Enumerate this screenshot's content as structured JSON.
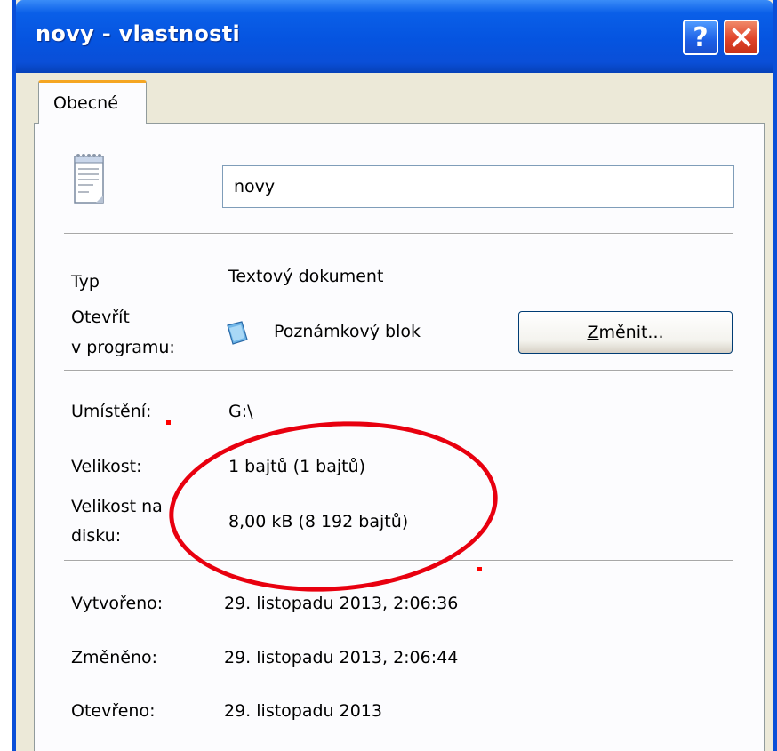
{
  "window": {
    "title": "novy - vlastnosti",
    "help_label": "?",
    "close_label": "✕"
  },
  "tabs": [
    {
      "label": "Obecné",
      "active": true
    }
  ],
  "file": {
    "icon": "notepad-document-icon",
    "name": "novy"
  },
  "props": {
    "type_label": "Typ",
    "type_value": "Textový dokument",
    "open_with_label_1": "Otevřít",
    "open_with_label_2": "v programu:",
    "open_with_app": "Poznámkový blok",
    "open_with_app_icon": "notepad-app-icon",
    "change_button_underline": "Z",
    "change_button_rest": "měnit...",
    "location_label": "Umístění:",
    "location_value": "G:\\",
    "size_label": "Velikost:",
    "size_value": "1 bajtů (1 bajtů)",
    "size_on_disk_label_1": "Velikost na",
    "size_on_disk_label_2": "disku:",
    "size_on_disk_value": "8,00 kB (8 192 bajtů)",
    "created_label": "Vytvořeno:",
    "created_value": "29. listopadu 2013, 2:06:36",
    "modified_label": "Změněno:",
    "modified_value": "29. listopadu 2013, 2:06:44",
    "accessed_label": "Otevřeno:",
    "accessed_value": "29. listopadu 2013"
  },
  "colors": {
    "titlebar": "#0554e0",
    "tab_accent": "#f5a623",
    "annotation": "#e8000f"
  }
}
